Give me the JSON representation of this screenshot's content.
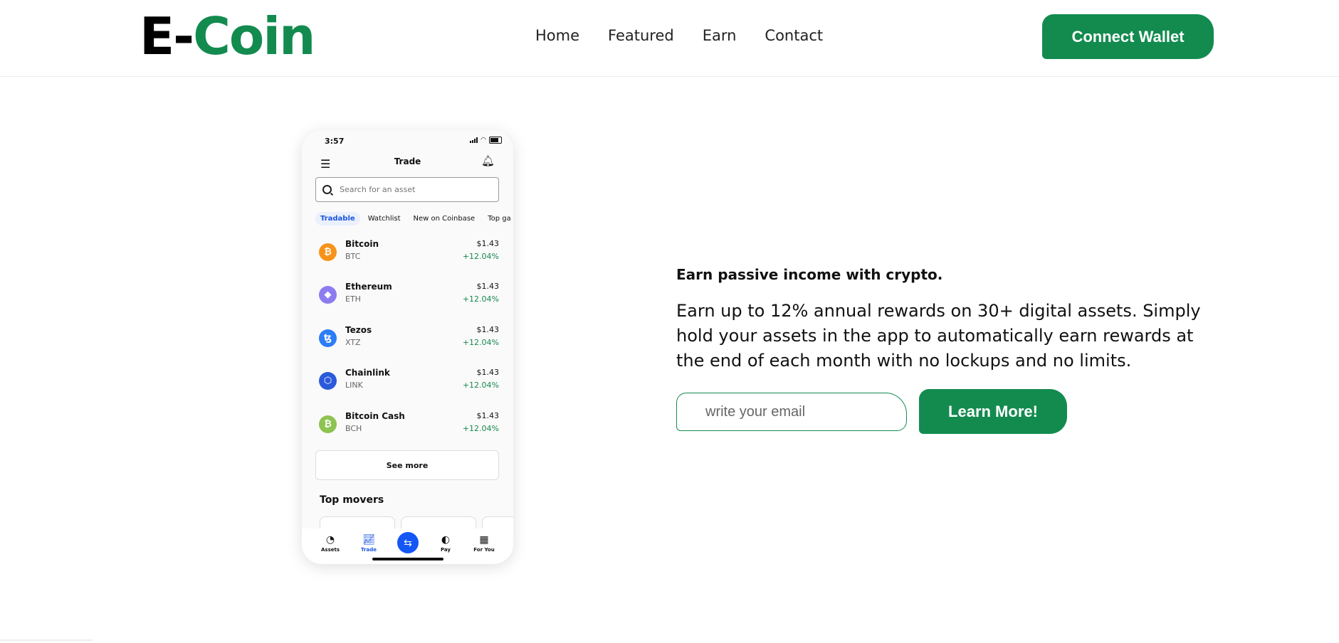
{
  "header": {
    "logo_part1": "E-",
    "logo_part2": "Coin",
    "nav": [
      "Home",
      "Featured",
      "Earn",
      "Contact"
    ],
    "connect_label": "Connect Wallet"
  },
  "phone": {
    "time": "3:57",
    "title": "Trade",
    "search_placeholder": "Search for an asset",
    "tabs": [
      "Tradable",
      "Watchlist",
      "New on Coinbase",
      "Top ga"
    ],
    "assets": [
      {
        "name": "Bitcoin",
        "symbol": "BTC",
        "price": "$1.43",
        "change": "+12.04%",
        "glyph": "₿",
        "color": "#f7931a"
      },
      {
        "name": "Ethereum",
        "symbol": "ETH",
        "price": "$1.43",
        "change": "+12.04%",
        "glyph": "◆",
        "color": "#8c7cf0"
      },
      {
        "name": "Tezos",
        "symbol": "XTZ",
        "price": "$1.43",
        "change": "+12.04%",
        "glyph": "ꜩ",
        "color": "#2c7df7"
      },
      {
        "name": "Chainlink",
        "symbol": "LINK",
        "price": "$1.43",
        "change": "+12.04%",
        "glyph": "⬡",
        "color": "#2a5ada"
      },
      {
        "name": "Bitcoin Cash",
        "symbol": "BCH",
        "price": "$1.43",
        "change": "+12.04%",
        "glyph": "₿",
        "color": "#8dc351"
      }
    ],
    "see_more": "See more",
    "top_movers": "Top movers",
    "bottom_nav": [
      "Assets",
      "Trade",
      "Pay",
      "For You"
    ]
  },
  "hero": {
    "headline": "Earn passive income with crypto.",
    "description": "Earn up to 12% annual rewards on 30+ digital assets. Simply hold your assets in the app to automatically earn rewards at the end of each month with no lockups and no limits.",
    "email_placeholder": "write your email",
    "cta_label": "Learn More!"
  },
  "colors": {
    "brand": "#138b4f",
    "accent_blue": "#1457f5"
  }
}
